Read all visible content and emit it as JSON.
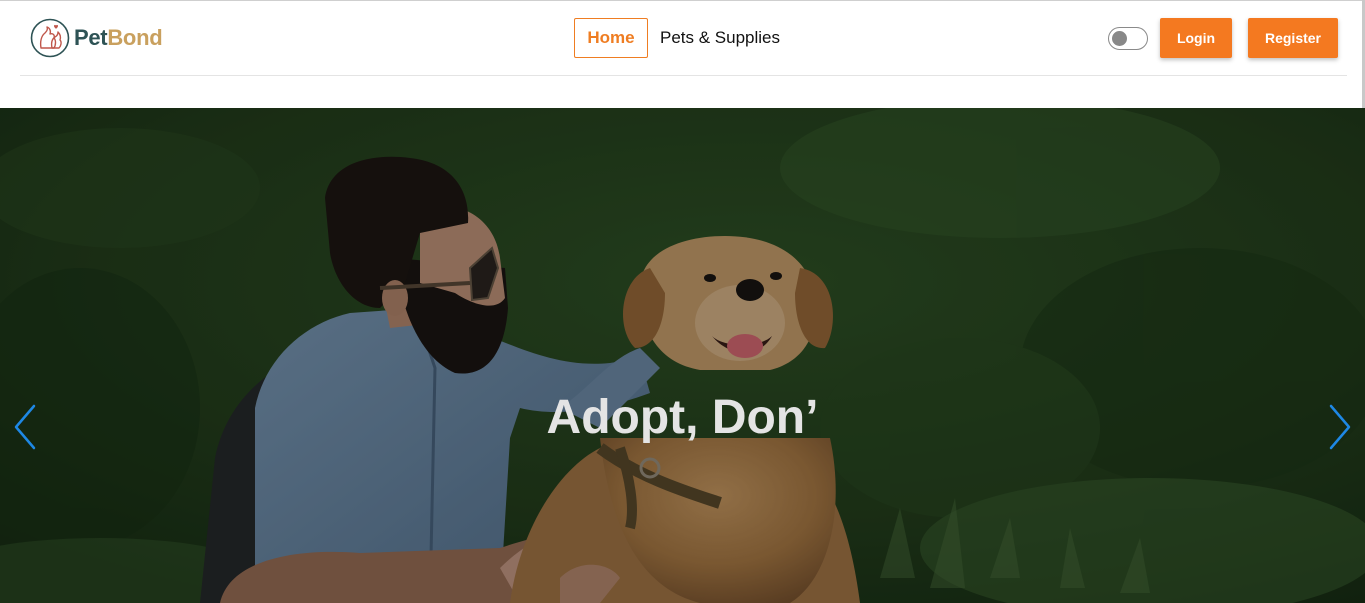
{
  "brand": {
    "name_part1": "Pet",
    "name_part2": "Bond",
    "logo_icon": "pet-heart-logo-icon",
    "color_primary": "#2e5355",
    "color_secondary": "#c9a05e"
  },
  "nav": {
    "items": [
      {
        "label": "Home",
        "active": true
      },
      {
        "label": "Pets & Supplies",
        "active": false
      }
    ]
  },
  "theme_toggle": {
    "state": "off",
    "icon": "toggle-icon"
  },
  "auth": {
    "login_label": "Login",
    "register_label": "Register",
    "accent_color": "#f47920"
  },
  "hero": {
    "caption": "Adopt, Don’",
    "image_subject": "man with sunglasses petting golden retriever in grass",
    "prev_icon": "chevron-left-icon",
    "next_icon": "chevron-right-icon",
    "arrow_color": "#1e88e5"
  }
}
